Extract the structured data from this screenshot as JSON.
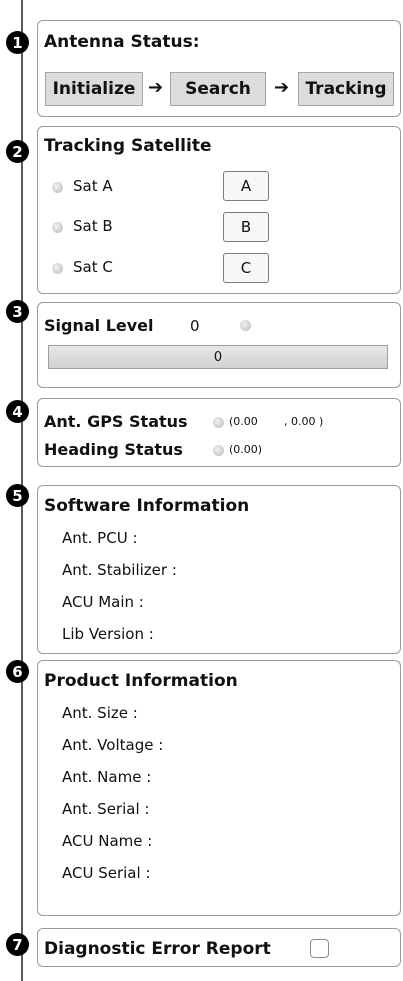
{
  "antenna": {
    "number": "1",
    "title": "Antenna Status:",
    "steps": [
      "Initialize",
      "Search",
      "Tracking"
    ],
    "arrow": "➔"
  },
  "tracking": {
    "number": "2",
    "title": "Tracking Satellite",
    "sats": [
      {
        "label": "Sat A",
        "button": "A"
      },
      {
        "label": "Sat B",
        "button": "B"
      },
      {
        "label": "Sat C",
        "button": "C"
      }
    ]
  },
  "signal": {
    "number": "3",
    "title": "Signal Level",
    "value": "0",
    "bar_value": "0"
  },
  "gps": {
    "number": "4",
    "gps_label": "Ant. GPS Status",
    "gps_lat": "(0.00",
    "gps_lon": ", 0.00 )",
    "heading_label": "Heading Status",
    "heading_value": "(0.00)"
  },
  "software": {
    "number": "5",
    "title": "Software Information",
    "items": [
      "Ant. PCU :",
      "Ant. Stabilizer :",
      "ACU Main :",
      "Lib Version :"
    ]
  },
  "product": {
    "number": "6",
    "title": "Product Information",
    "items": [
      "Ant. Size :",
      "Ant. Voltage :",
      "Ant. Name :",
      "Ant. Serial :",
      "ACU Name :",
      "ACU Serial :"
    ]
  },
  "diagnostic": {
    "number": "7",
    "label": "Diagnostic Error Report"
  }
}
